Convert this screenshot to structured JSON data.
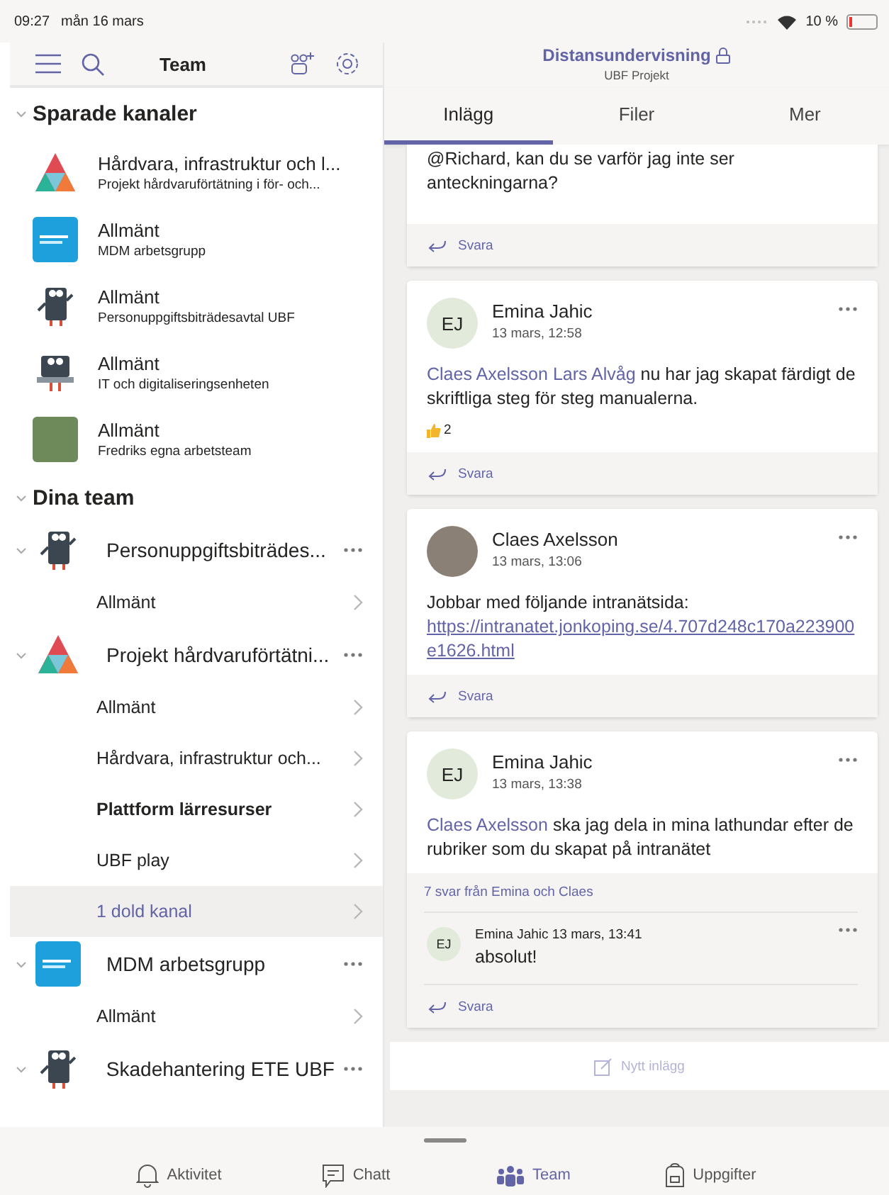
{
  "status_bar": {
    "time": "09:27",
    "date": "mån 16 mars",
    "battery": "10 %"
  },
  "sidebar": {
    "title": "Team",
    "saved_channels": {
      "title": "Sparade kanaler",
      "expanded": true,
      "items": [
        {
          "kind": "triangle",
          "name": "Hårdvara, infrastruktur och l...",
          "team": "Projekt hårdvaruförtätning i för- och..."
        },
        {
          "kind": "tile",
          "name": "Allmänt",
          "team": "MDM arbetsgrupp"
        },
        {
          "kind": "robot",
          "name": "Allmänt",
          "team": "Personuppgiftsbiträdesavtal UBF"
        },
        {
          "kind": "laptop",
          "name": "Allmänt",
          "team": "IT och digitaliseringsenheten"
        },
        {
          "kind": "photo",
          "name": "Allmänt",
          "team": "Fredriks egna arbetsteam"
        }
      ]
    },
    "your_teams": {
      "title": "Dina team",
      "expanded": true,
      "teams": [
        {
          "kind": "robot",
          "name": "Personuppgiftsbiträdes...",
          "expanded": true,
          "channels": [
            {
              "kind": "channel",
              "name": "Allmänt",
              "unread": false,
              "selected": false
            }
          ]
        },
        {
          "kind": "triangle",
          "name": "Projekt hårdvaruförtätni...",
          "expanded": true,
          "channels": [
            {
              "kind": "channel",
              "name": "Allmänt",
              "unread": false,
              "selected": false
            },
            {
              "kind": "channel",
              "name": "Hårdvara, infrastruktur och...",
              "unread": false,
              "selected": false
            },
            {
              "kind": "channel",
              "name": "Plattform lärresurser",
              "unread": true,
              "selected": false
            },
            {
              "kind": "channel",
              "name": "UBF play",
              "unread": false,
              "selected": false
            },
            {
              "kind": "hidden",
              "name": "1 dold kanal",
              "unread": false,
              "selected": true
            }
          ]
        },
        {
          "kind": "tile",
          "name": "MDM arbetsgrupp",
          "expanded": true,
          "channels": [
            {
              "kind": "channel",
              "name": "Allmänt",
              "unread": false,
              "selected": false
            }
          ]
        },
        {
          "kind": "robot",
          "name": "Skadehantering ETE UBF",
          "expanded": true
        }
      ]
    }
  },
  "channel": {
    "title": "Distansundervisning",
    "private": true,
    "team": "UBF Projekt",
    "tabs": [
      {
        "label": "Inlägg",
        "selected": true
      },
      {
        "label": "Filer",
        "selected": false
      },
      {
        "label": "Mer",
        "selected": false
      }
    ],
    "posts": [
      {
        "partial": true,
        "body": [
          {
            "kind": "text",
            "text": "@Richard, kan du se varför jag inte ser anteckningarna?"
          }
        ],
        "reply_label": "Svara"
      },
      {
        "partial": false,
        "author": "Emina Jahic",
        "initials": "EJ",
        "time": "13 mars, 12:58",
        "body": [
          {
            "kind": "mention",
            "text": "Claes Axelsson "
          },
          {
            "kind": "mention",
            "text": "Lars Alvåg"
          },
          {
            "kind": "text",
            "text": " nu har jag skapat färdigt de skriftliga steg för steg manualerna."
          }
        ],
        "likes": "2",
        "reply_label": "Svara"
      },
      {
        "partial": false,
        "author": "Claes Axelsson",
        "time": "13 mars, 13:06",
        "body": [
          {
            "kind": "text",
            "text": "Jobbar med följande intranätsida: "
          },
          {
            "kind": "link",
            "text": "https://intranatet.jonkoping.se/4.707d248c170a223900e1626.html"
          }
        ],
        "reply_label": "Svara"
      },
      {
        "partial": false,
        "author": "Emina Jahic",
        "initials": "EJ",
        "time": "13 mars, 13:38",
        "body": [
          {
            "kind": "mention",
            "text": "Claes Axelsson"
          },
          {
            "kind": "text",
            "text": " ska jag dela in mina lathundar efter de rubriker som du skapat på intranätet"
          }
        ],
        "reply_summary": "7 svar från Emina och Claes",
        "replies": [
          {
            "author": "Emina Jahic",
            "initials": "EJ",
            "time": "13 mars, 13:41",
            "text": "absolut!"
          }
        ],
        "reply_label": "Svara"
      }
    ],
    "new_post": "Nytt inlägg"
  },
  "bottom_tabs": [
    {
      "kind": "bell",
      "label": "Aktivitet",
      "selected": false
    },
    {
      "kind": "chat",
      "label": "Chatt",
      "selected": false
    },
    {
      "kind": "team",
      "label": "Team",
      "selected": true
    },
    {
      "kind": "tasks",
      "label": "Uppgifter",
      "selected": false
    }
  ]
}
